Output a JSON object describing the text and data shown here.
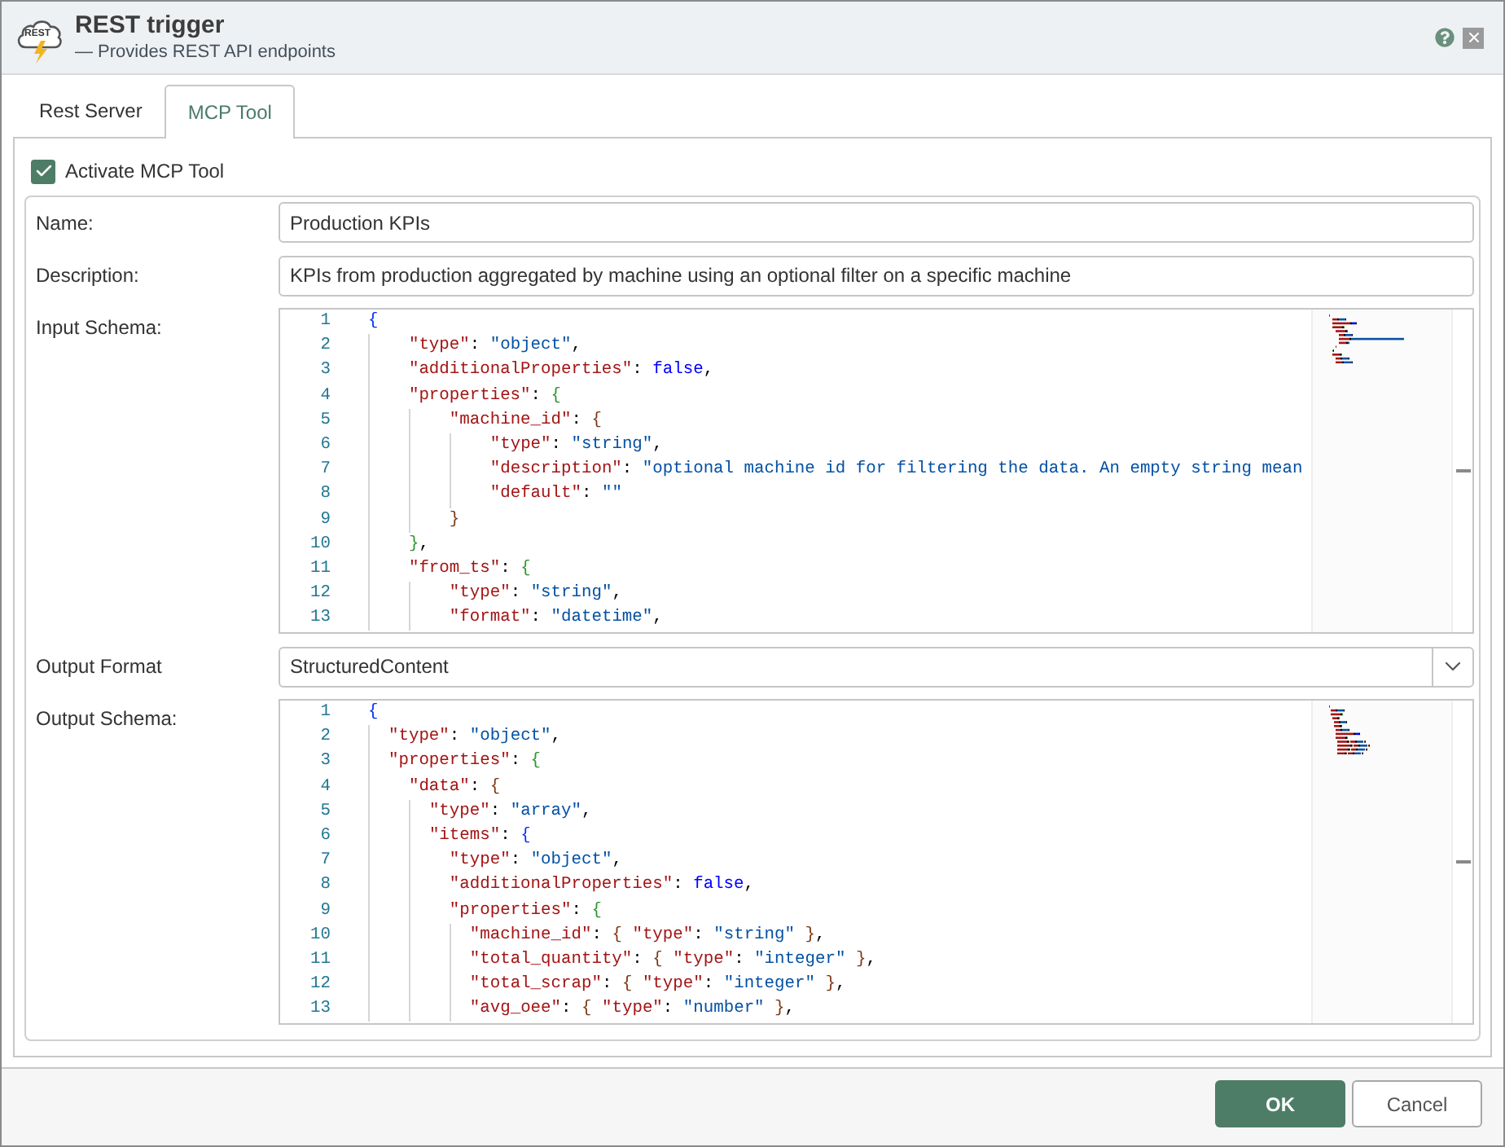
{
  "window": {
    "title": "REST trigger",
    "subtitle": "— Provides REST API endpoints",
    "logo_text": "REST"
  },
  "tabs": [
    {
      "label": "Rest Server",
      "selected": false
    },
    {
      "label": "MCP Tool",
      "selected": true
    }
  ],
  "activate": {
    "label": "Activate MCP Tool",
    "checked": true
  },
  "fields": [
    {
      "kind": "text",
      "label": "Name:",
      "value": "Production KPIs"
    },
    {
      "kind": "text",
      "label": "Description:",
      "value": "KPIs from production aggregated by machine using an optional filter on a specific machine"
    },
    {
      "kind": "code",
      "label": "Input Schema:",
      "lines": [
        {
          "number": "1",
          "text": "{"
        },
        {
          "number": "2",
          "text": "    \"type\": \"object\","
        },
        {
          "number": "3",
          "text": "    \"additionalProperties\": false,"
        },
        {
          "number": "4",
          "text": "    \"properties\": {"
        },
        {
          "number": "5",
          "text": "        \"machine_id\": {"
        },
        {
          "number": "6",
          "text": "            \"type\": \"string\","
        },
        {
          "number": "7",
          "text": "            \"description\": \"optional machine id for filtering the data. An empty string mean"
        },
        {
          "number": "8",
          "text": "            \"default\": \"\""
        },
        {
          "number": "9",
          "text": "        }"
        },
        {
          "number": "10",
          "text": "    },"
        },
        {
          "number": "11",
          "text": "    \"from_ts\": {"
        },
        {
          "number": "12",
          "text": "        \"type\": \"string\","
        },
        {
          "number": "13",
          "text": "        \"format\": \"datetime\","
        }
      ]
    },
    {
      "kind": "select",
      "label": "Output Format",
      "value": "StructuredContent"
    },
    {
      "kind": "code",
      "label": "Output Schema:",
      "lines": [
        {
          "number": "1",
          "text": "{"
        },
        {
          "number": "2",
          "text": "  \"type\": \"object\","
        },
        {
          "number": "3",
          "text": "  \"properties\": {"
        },
        {
          "number": "4",
          "text": "    \"data\": {"
        },
        {
          "number": "5",
          "text": "      \"type\": \"array\","
        },
        {
          "number": "6",
          "text": "      \"items\": {"
        },
        {
          "number": "7",
          "text": "        \"type\": \"object\","
        },
        {
          "number": "8",
          "text": "        \"additionalProperties\": false,"
        },
        {
          "number": "9",
          "text": "        \"properties\": {"
        },
        {
          "number": "10",
          "text": "          \"machine_id\": { \"type\": \"string\" },"
        },
        {
          "number": "11",
          "text": "          \"total_quantity\": { \"type\": \"integer\" },"
        },
        {
          "number": "12",
          "text": "          \"total_scrap\": { \"type\": \"integer\" },"
        },
        {
          "number": "13",
          "text": "          \"avg_oee\": { \"type\": \"number\" },"
        }
      ]
    }
  ],
  "buttons": [
    {
      "label": "OK",
      "kind": "primary"
    },
    {
      "label": "Cancel",
      "kind": "secondary"
    }
  ]
}
